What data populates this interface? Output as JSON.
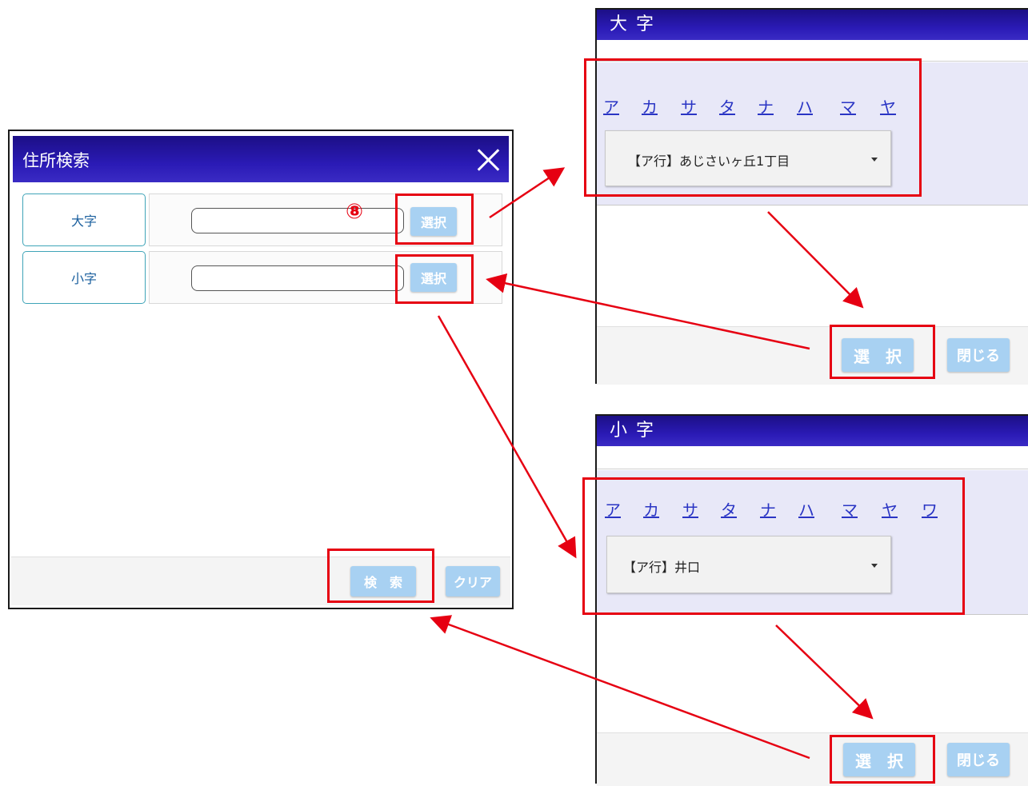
{
  "main_dialog": {
    "title": "住所検索",
    "rows": [
      {
        "label": "大字",
        "value": "",
        "button": "選択"
      },
      {
        "label": "小字",
        "value": "",
        "button": "選択"
      }
    ],
    "search_button": "検　索",
    "clear_button": "クリア"
  },
  "annotation": {
    "step_marker": "⑧"
  },
  "oaza_panel": {
    "title": "大字",
    "kana": [
      "ア",
      "カ",
      "サ",
      "タ",
      "ナ",
      "ハ",
      "マ",
      "ヤ"
    ],
    "selected": "【ア行】あじさいヶ丘1丁目",
    "select_button": "選　択",
    "close_button": "閉じる"
  },
  "koaza_panel": {
    "title": "小字",
    "kana": [
      "ア",
      "カ",
      "サ",
      "タ",
      "ナ",
      "ハ",
      "マ",
      "ヤ",
      "ワ"
    ],
    "selected": "【ア行】井口",
    "select_button": "選　択",
    "close_button": "閉じる"
  },
  "colors": {
    "title_bar": "#2a1ab5",
    "button": "#a8d1f2",
    "annotation_red": "#e60012",
    "kana_link": "#2a35c4"
  }
}
